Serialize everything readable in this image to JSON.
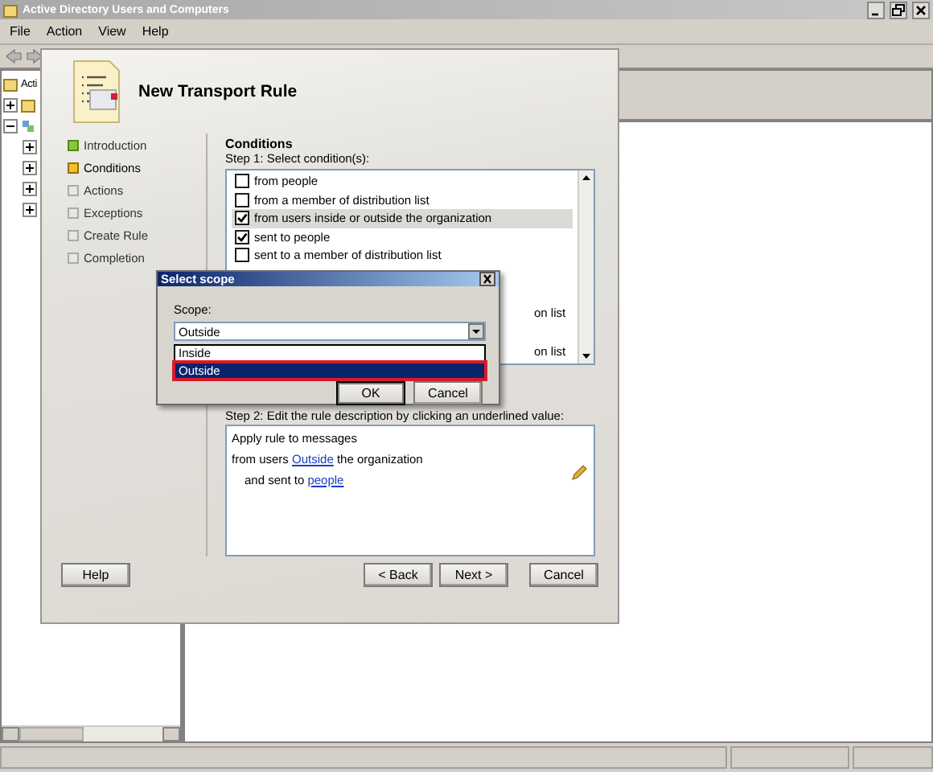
{
  "window": {
    "title": "Active Directory Users and Computers"
  },
  "menu": [
    "File",
    "Action",
    "View",
    "Help"
  ],
  "tree": {
    "root": "Acti",
    "nodes": [
      {
        "expanded": false
      },
      {
        "expanded": true,
        "children": [
          {
            "expanded": false
          },
          {
            "expanded": false
          },
          {
            "expanded": false
          },
          {
            "expanded": false
          }
        ]
      }
    ]
  },
  "wizard": {
    "title": "New Transport Rule",
    "steps": [
      {
        "label": "Introduction",
        "complete": true,
        "selected": false
      },
      {
        "label": "Conditions",
        "complete": false,
        "selected": true
      },
      {
        "label": "Actions",
        "complete": false,
        "selected": false
      },
      {
        "label": "Exceptions",
        "complete": false,
        "selected": false
      },
      {
        "label": "Create Rule",
        "complete": false,
        "selected": false
      },
      {
        "label": "Completion",
        "complete": false,
        "selected": false
      }
    ],
    "section": "Conditions",
    "step1": "Step 1: Select condition(s):",
    "conditions": [
      {
        "kind": "item",
        "label": "from people",
        "checked": false,
        "selected": false
      },
      {
        "kind": "item",
        "label": "from a member of distribution list",
        "checked": false,
        "selected": false
      },
      {
        "kind": "item",
        "label": "from users inside or outside the organization",
        "checked": true,
        "selected": true
      },
      {
        "kind": "item",
        "label": "sent to people",
        "checked": true,
        "selected": false
      },
      {
        "kind": "item",
        "label": "sent to a member of distribution list",
        "checked": false,
        "selected": false
      },
      {
        "kind": "fragment",
        "label": "on list"
      },
      {
        "kind": "fragment",
        "label": "on list"
      }
    ],
    "step2": "Step 2: Edit the rule description by clicking an underlined value:",
    "description": [
      {
        "kind": "line",
        "parts": [
          {
            "text": "Apply rule to messages",
            "link": false
          }
        ]
      },
      {
        "kind": "line",
        "parts": [
          {
            "text": "from users ",
            "link": false
          },
          {
            "text": "Outside",
            "link": true
          },
          {
            "text": " the organization",
            "link": false
          }
        ]
      },
      {
        "kind": "sub",
        "parts": [
          {
            "text": "and sent to ",
            "link": false
          },
          {
            "text": "people",
            "link": true
          }
        ]
      }
    ],
    "buttons": [
      {
        "kind": "help",
        "label": "Help"
      },
      {
        "kind": "back",
        "label": "< Back"
      },
      {
        "kind": "next",
        "label": "Next >"
      },
      {
        "kind": "cancel",
        "label": "Cancel"
      }
    ]
  },
  "scope_dialog": {
    "title": "Select scope",
    "label": "Scope:",
    "value": "Outside",
    "options": [
      {
        "label": "Inside",
        "selected": false
      },
      {
        "label": "Outside",
        "selected": true
      }
    ],
    "buttons": [
      {
        "kind": "ok",
        "label": "OK"
      },
      {
        "kind": "cancel",
        "label": "Cancel"
      }
    ]
  }
}
